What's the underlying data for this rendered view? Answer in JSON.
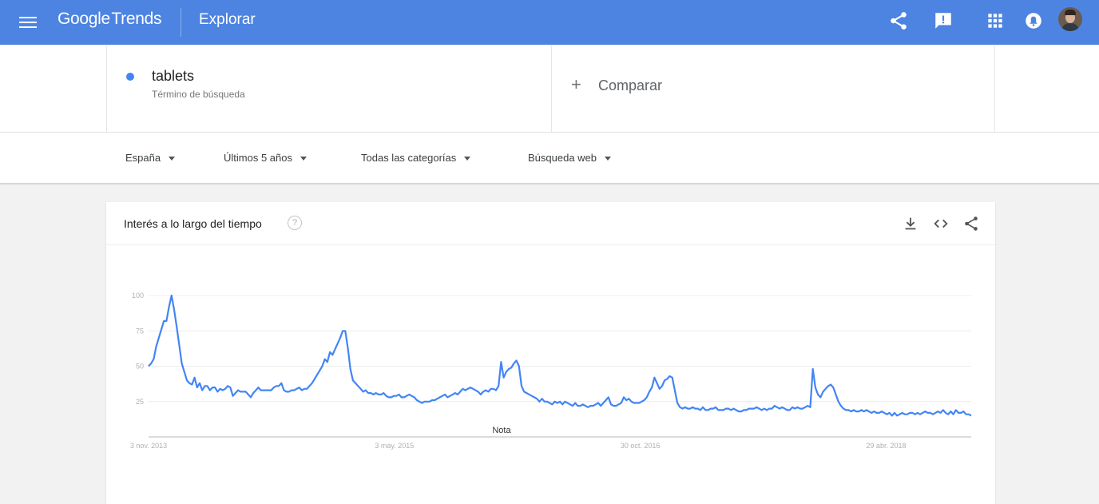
{
  "header": {
    "logo_google": "Google",
    "logo_trends": "Trends",
    "section": "Explorar",
    "icons": [
      "share-icon",
      "feedback-icon",
      "apps-grid-icon",
      "notifications-icon",
      "account-avatar"
    ]
  },
  "search_term": {
    "name": "tablets",
    "type": "Término de búsqueda",
    "color": "#4285f4"
  },
  "compare": {
    "plus": "+",
    "label": "Comparar"
  },
  "filters": {
    "region": "España",
    "period": "Últimos 5 años",
    "category": "Todas las categorías",
    "search_type": "Búsqueda web"
  },
  "card": {
    "title": "Interés a lo largo del tiempo",
    "help": "?"
  },
  "colors": {
    "topbar": "#4d84e2",
    "line": "#4285f4"
  },
  "chart_data": {
    "type": "line",
    "title": "",
    "xlabel": "",
    "ylabel": "",
    "ylim": [
      0,
      100
    ],
    "yticks": [
      25,
      50,
      75,
      100
    ],
    "x_tick_labels": [
      "3 nov. 2013",
      "3 may. 2015",
      "30 oct. 2016",
      "29 abr. 2018"
    ],
    "x_tick_weeks": [
      0,
      78,
      156,
      234
    ],
    "x_range_weeks": [
      0,
      261
    ],
    "annotation": {
      "text": "Nota",
      "week": 112
    },
    "grid": true,
    "series": [
      {
        "values": [
          50,
          52,
          55,
          64,
          70,
          76,
          82,
          82,
          92,
          100,
          90,
          78,
          65,
          52,
          46,
          40,
          38,
          37,
          42,
          35,
          38,
          33,
          36,
          36,
          33,
          35,
          35,
          32,
          34,
          33,
          34,
          36,
          35,
          29,
          31,
          33,
          32,
          32,
          32,
          30,
          28,
          31,
          33,
          35,
          33,
          33,
          33,
          33,
          33,
          35,
          36,
          36,
          38,
          33,
          32,
          32,
          33,
          33,
          34,
          35,
          33,
          34,
          34,
          36,
          38,
          41,
          44,
          47,
          50,
          55,
          53,
          60,
          58,
          62,
          66,
          70,
          75,
          75,
          63,
          48,
          40,
          38,
          36,
          34,
          32,
          33,
          31,
          31,
          30,
          31,
          30,
          30,
          31,
          29,
          28,
          28,
          29,
          29,
          30,
          28,
          28,
          29,
          30,
          29,
          28,
          26,
          25,
          24,
          25,
          25,
          25,
          26,
          26,
          27,
          28,
          29,
          30,
          28,
          29,
          30,
          31,
          30,
          32,
          34,
          33,
          34,
          35,
          34,
          33,
          32,
          30,
          32,
          33,
          32,
          34,
          34,
          33,
          36,
          53,
          42,
          46,
          48,
          49,
          52,
          54,
          50,
          36,
          32,
          31,
          30,
          29,
          28,
          27,
          25,
          27,
          25,
          25,
          24,
          23,
          25,
          24,
          25,
          23,
          25,
          24,
          23,
          22,
          24,
          22,
          22,
          23,
          22,
          21,
          22,
          22,
          23,
          24,
          22,
          24,
          26,
          28,
          23,
          22,
          22,
          23,
          24,
          28,
          26,
          27,
          25,
          24,
          24,
          24,
          25,
          26,
          28,
          32,
          35,
          42,
          38,
          34,
          36,
          40,
          41,
          43,
          42,
          33,
          24,
          21,
          20,
          21,
          20,
          20,
          21,
          20,
          20,
          19,
          21,
          19,
          19,
          20,
          20,
          21,
          19,
          19,
          19,
          20,
          20,
          19,
          20,
          19,
          18,
          18,
          19,
          19,
          20,
          20,
          20,
          21,
          20,
          19,
          20,
          19,
          20,
          20,
          22,
          21,
          20,
          21,
          20,
          19,
          19,
          21,
          20,
          21,
          20,
          20,
          21,
          22,
          21,
          48,
          35,
          30,
          28,
          32,
          34,
          36,
          37,
          35,
          30,
          25,
          22,
          20,
          19,
          19,
          18,
          19,
          18,
          18,
          19,
          18,
          19,
          18,
          17,
          18,
          17,
          17,
          18,
          17,
          16,
          17,
          15,
          17,
          15,
          16,
          17,
          16,
          16,
          17,
          17,
          16,
          17,
          16,
          17,
          18,
          17,
          17,
          16,
          17,
          18,
          17,
          19,
          17,
          16,
          18,
          16,
          19,
          17,
          17,
          18,
          16,
          16,
          15
        ]
      }
    ]
  }
}
